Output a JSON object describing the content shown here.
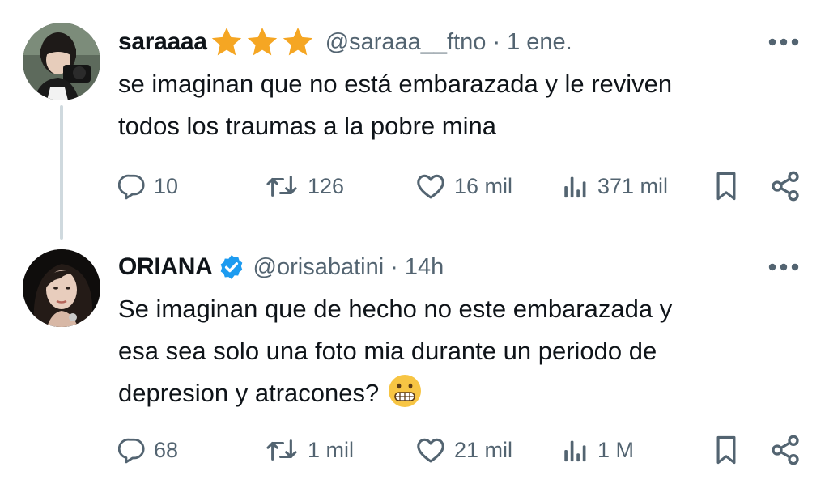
{
  "tweets": [
    {
      "name": "saraaaa",
      "name_decoration": "star-icon x3",
      "handle": "@saraaa__ftno",
      "time": "1 ene.",
      "line1": "se imaginan que no está embarazada y le reviven",
      "line2": "todos los traumas a la pobre mina",
      "stats": {
        "replies": "10",
        "retweets": "126",
        "likes": "16 mil",
        "views": "371 mil"
      }
    },
    {
      "name": "ORIANA",
      "verified": true,
      "handle": "@orisabatini",
      "time": "14h",
      "line1": "Se imaginan que de hecho no este embarazada y",
      "line2": "esa sea solo una foto mia durante un periodo de",
      "line3": "depresion y atracones?",
      "emoji": "grimacing-face-emoji",
      "stats": {
        "replies": "68",
        "retweets": "1 mil",
        "likes": "21 mil",
        "views": "1 M"
      }
    }
  ],
  "colors": {
    "text": "#0f1419",
    "secondary": "#536471",
    "verified_blue": "#1d9bf0",
    "star_orange": "#f5a623",
    "thread_line": "#cfd9de"
  }
}
